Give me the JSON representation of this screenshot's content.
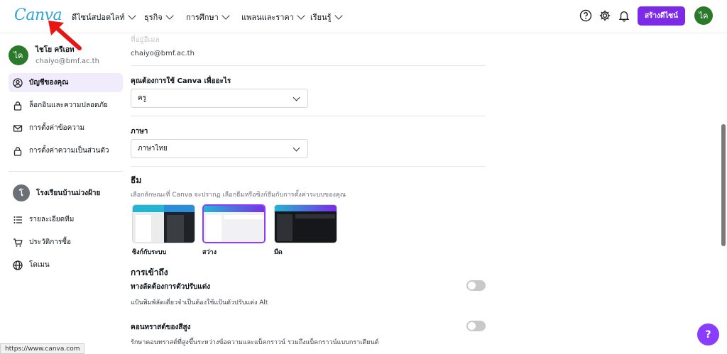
{
  "topbar": {
    "logo": "Canva",
    "nav": [
      {
        "label": "ดีไซน์สปอตไลท์"
      },
      {
        "label": "ธุรกิจ"
      },
      {
        "label": "การศึกษา"
      },
      {
        "label": "แพลนและราคา"
      },
      {
        "label": "เรียนรู้"
      }
    ],
    "create_label": "สร้างดีไซน์",
    "avatar_initials": "ไค",
    "icons": [
      "help-circle-icon",
      "gear-icon",
      "bell-icon"
    ]
  },
  "sidebar": {
    "user": {
      "initials": "ไค",
      "name": "ไชโย ครีเอท",
      "email": "chaiyo@bmf.ac.th"
    },
    "items": [
      {
        "label": "บัญชีของคุณ",
        "icon": "user-circle-icon"
      },
      {
        "label": "ล็อกอินและความปลอดภัย",
        "icon": "lock-icon"
      },
      {
        "label": "การตั้งค่าข้อความ",
        "icon": "mail-icon"
      },
      {
        "label": "การตั้งค่าความเป็นส่วนตัว",
        "icon": "lock-icon"
      }
    ],
    "team": {
      "initials": "โ",
      "name": "โรงเรียนบ้านม่วงฝ้าย"
    },
    "team_items": [
      {
        "label": "รายละเอียดทีม",
        "icon": "list-icon"
      },
      {
        "label": "ประวัติการซื้อ",
        "icon": "cart-icon"
      },
      {
        "label": "โดเมน",
        "icon": "globe-icon"
      }
    ]
  },
  "main": {
    "faded_label": "ที่อยู่อีเมล",
    "email": "chaiyo@bmf.ac.th",
    "usage": {
      "label": "คุณต้องการใช้ Canva เพื่ออะไร",
      "value": "ครู"
    },
    "language": {
      "label": "ภาษา",
      "value": "ภาษาไทย"
    },
    "theme": {
      "title": "ธีม",
      "desc": "เลือกลักษณะที่ Canva จะปรากฏ เลือกธีมหรือซิงก์ธีมกับการตั้งค่าระบบของคุณ",
      "options": [
        {
          "label": "ซิงก์กับระบบ"
        },
        {
          "label": "สว่าง"
        },
        {
          "label": "มืด"
        }
      ]
    },
    "accessibility": {
      "title": "การเข้าถึง",
      "items": [
        {
          "title": "ทางลัดต้องการตัวปรับแต่ง",
          "desc": "แป้นพิมพ์ลัดเดี่ยวจำเป็นต้องใช้แป้นตัวปรับแต่ง Alt"
        },
        {
          "title": "คอนทราสต์ของสีสูง",
          "desc": "รักษาคอนทราสต์ที่สูงขึ้นระหว่างข้อความและแบ็คกราวน์ รวมถึงแบ็คกราวน์แบบกราเดียนต์"
        }
      ]
    }
  },
  "help_label": "?",
  "status_url": "https://www.canva.com",
  "colors": {
    "accent": "#7d2ae8",
    "avatar": "#2b7a2b",
    "logo": "#2fa4d8"
  }
}
